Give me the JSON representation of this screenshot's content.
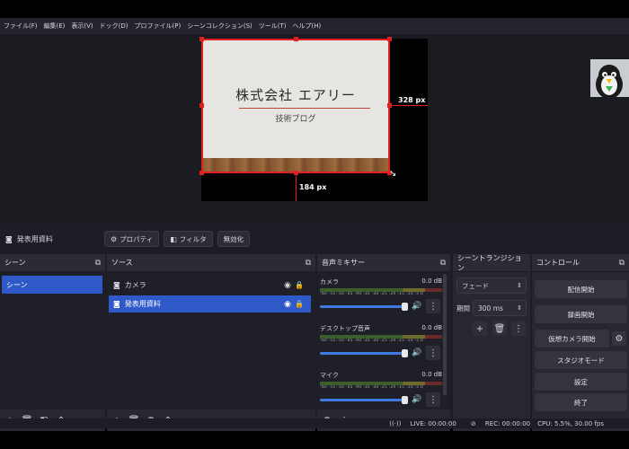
{
  "menu": [
    "ファイル(F)",
    "編集(E)",
    "表示(V)",
    "ドック(D)",
    "プロファイル(P)",
    "シーンコレクション(S)",
    "ツール(T)",
    "ヘルプ(H)"
  ],
  "preview": {
    "slide_title": "株式会社 エアリー",
    "slide_subtitle": "技術ブログ",
    "px_right": "328 px",
    "px_bottom": "184 px"
  },
  "source_bar": {
    "selected_source": "発表用資料",
    "properties_label": "プロパティ",
    "filters_label": "フィルタ",
    "disable_label": "無効化"
  },
  "scenes": {
    "title": "シーン",
    "items": [
      "シーン"
    ]
  },
  "sources": {
    "title": "ソース",
    "items": [
      {
        "label": "カメラ",
        "selected": false
      },
      {
        "label": "発表用資料",
        "selected": true
      }
    ]
  },
  "mixer": {
    "title": "音声ミキサー",
    "ticks": "-60 -55 -50 -45 -40 -35 -30 -25 -20 -15 -10 -5 0",
    "channels": [
      {
        "name": "カメラ",
        "level": "0.0 dB"
      },
      {
        "name": "デスクトップ音声",
        "level": "0.0 dB"
      },
      {
        "name": "マイク",
        "level": "0.0 dB"
      }
    ]
  },
  "transitions": {
    "title": "シーントランジション",
    "type": "フェード",
    "duration_label": "期間",
    "duration_value": "300 ms"
  },
  "controls": {
    "title": "コントロール",
    "buttons": [
      "配信開始",
      "録画開始",
      "仮想カメラ開始",
      "スタジオモード",
      "設定",
      "終了"
    ]
  },
  "status": {
    "live": "LIVE: 00:00:00",
    "rec": "REC: 00:00:00",
    "cpu": "CPU: 5.5%, 30.00 fps"
  },
  "colors": {
    "selection": "#2f58c8",
    "transform_box": "#e02020"
  }
}
